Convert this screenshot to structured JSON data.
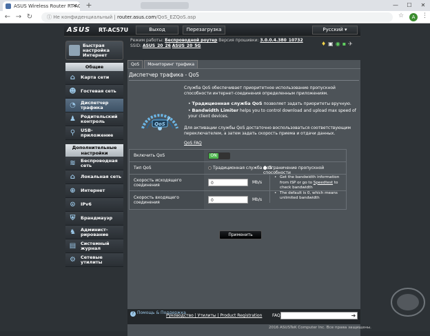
{
  "browser": {
    "tab_title": "ASUS Wireless Router RT-AC57U",
    "security_label": "Не конфиденциальный",
    "url_host": "router.asus.com",
    "url_path": "/QoS_EZQoS.asp",
    "profile_initial": "A"
  },
  "header": {
    "logo": "ASUS",
    "model": "RT-AC57U",
    "logout": "Выход",
    "reboot": "Перезагрузка",
    "language": "Русский"
  },
  "info": {
    "mode_label": "Режим работы:",
    "mode_value": "Беспроводной роутер",
    "firmware_label": "Версия прошивки:",
    "firmware_value": "3.0.0.4.380_10732",
    "ssid_label": "SSID:",
    "ssid1": "ASUS_20_26",
    "ssid2": "ASUS_20_5G"
  },
  "sidebar": {
    "qis": "Быстрая настройка Интернет",
    "general_header": "Общие",
    "general": [
      {
        "label": "Карта сети",
        "icon": "network-map-icon"
      },
      {
        "label": "Гостевая сеть",
        "icon": "guest-network-icon"
      },
      {
        "label": "Диспетчер трафика",
        "icon": "traffic-manager-icon"
      },
      {
        "label": "Родительский контроль",
        "icon": "parental-control-icon"
      },
      {
        "label": "USB-приложение",
        "icon": "usb-icon"
      }
    ],
    "advanced_header": "Дополнительные настройки",
    "advanced": [
      {
        "label": "Беспроводная сеть",
        "icon": "wireless-icon"
      },
      {
        "label": "Локальная сеть",
        "icon": "lan-icon"
      },
      {
        "label": "Интернет",
        "icon": "globe-icon"
      },
      {
        "label": "IPv6",
        "icon": "ipv6-icon"
      },
      {
        "label": "Брандмауэр",
        "icon": "firewall-icon"
      },
      {
        "label": "Админист­рирование",
        "icon": "admin-icon"
      },
      {
        "label": "Системный журнал",
        "icon": "log-icon"
      },
      {
        "label": "Сетевые утилиты",
        "icon": "tools-icon"
      }
    ]
  },
  "main": {
    "tabs": [
      "QoS",
      "Мониторинг трафика"
    ],
    "title": "Диспетчер трафика - QoS",
    "gauge_label": "QoS",
    "desc1": "Служба QoS обеспечивает приоритетное использование пропускной способности интернет-соединения определенным приложениям.",
    "bullet1_bold": "Традиционная служба QoS",
    "bullet1_rest": " позволяет задать приоритеты вручную.",
    "bullet2_bold": "Bandwidth Limiter",
    "bullet2_rest": " helps you to control download and upload max speed of your client devices.",
    "desc2": "Для активации службы QoS достаточно воспользоваться соответствующим переключателем, а затем задать скорость приема и отдачи данных.",
    "faq_link": "QoS FAQ",
    "rows": {
      "enable_label": "Включить QoS",
      "enable_value": "ON",
      "type_label": "Тип QoS",
      "type_opt1": "Традиционная служба QoS",
      "type_opt2": "Ограничение пропускной способности",
      "upload_label": "Скорость исходящего соединения",
      "upload_value": "0",
      "download_label": "Скорость входящего соединения",
      "download_value": "0",
      "unit": "Mb/s",
      "hint1a": "Get the bandwidth information from ISP or go to ",
      "hint1_link": "Speedtest",
      "hint1b": " to check bandwidth",
      "hint2": "The default is 0, which means unlimited bandwidth"
    },
    "apply": "Применить"
  },
  "footer": {
    "help": "Помощь & Поддержка",
    "links": "Руководство | Утилиты | Product Registration",
    "faq": "FAQ",
    "copyright": "2016 ASUSTeK Computer Inc. Все права защищены."
  }
}
